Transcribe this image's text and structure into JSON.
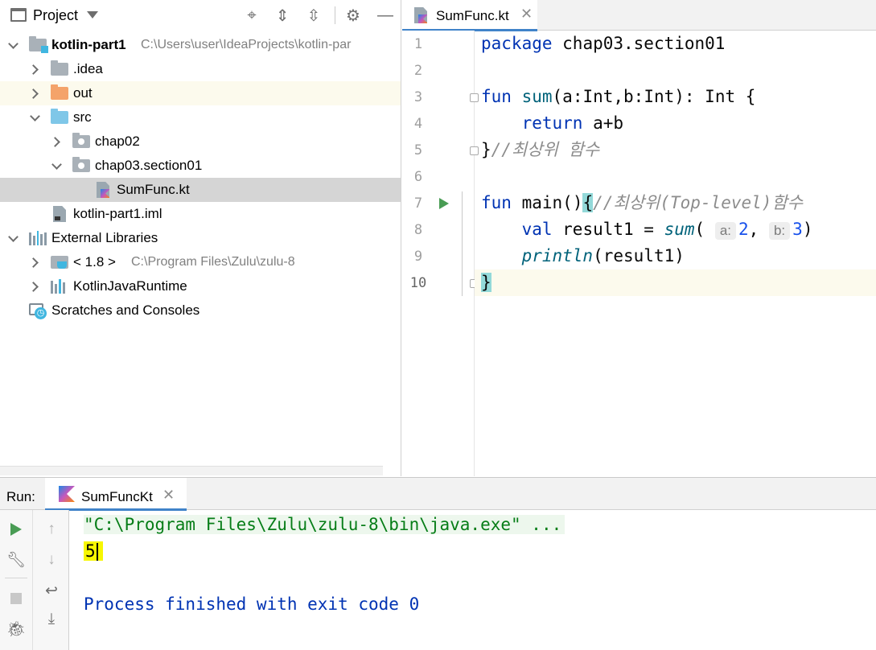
{
  "project_panel": {
    "title": "Project",
    "header_icons": [
      "locate-icon",
      "expand-all-icon",
      "collapse-all-icon",
      "gear-icon",
      "hide-icon"
    ],
    "tree": [
      {
        "label": "kotlin-part1",
        "path": "C:\\Users\\user\\IdeaProjects\\kotlin-par",
        "icon": "module-folder-icon",
        "expanded": true
      },
      {
        "label": ".idea",
        "icon": "folder-icon",
        "expanded": false
      },
      {
        "label": "out",
        "icon": "excluded-folder-icon",
        "expanded": false
      },
      {
        "label": "src",
        "icon": "source-folder-icon",
        "expanded": true
      },
      {
        "label": "chap02",
        "icon": "package-icon",
        "expanded": false
      },
      {
        "label": "chap03.section01",
        "icon": "package-icon",
        "expanded": true
      },
      {
        "label": "SumFunc.kt",
        "icon": "kotlin-file-icon",
        "selected": true
      },
      {
        "label": "kotlin-part1.iml",
        "icon": "iml-file-icon"
      },
      {
        "label": "External Libraries",
        "icon": "library-icon",
        "expanded": true
      },
      {
        "label": "< 1.8 >",
        "path": "C:\\Program Files\\Zulu\\zulu-8",
        "icon": "jdk-icon",
        "expanded": false
      },
      {
        "label": "KotlinJavaRuntime",
        "icon": "library-icon",
        "expanded": false
      },
      {
        "label": "Scratches and Consoles",
        "icon": "scratches-icon"
      }
    ]
  },
  "editor": {
    "tab_label": "SumFunc.kt",
    "tab_close": "✕",
    "line_numbers": [
      "1",
      "2",
      "3",
      "4",
      "5",
      "6",
      "7",
      "8",
      "9",
      "10"
    ],
    "code": {
      "l1_kw": "package",
      "l1_rest": " chap03.section01",
      "l3_kw": "fun",
      "l3_name": "sum",
      "l3_rest": "(a:Int,b:Int): Int {",
      "l4_kw": "return",
      "l4_rest": " a+b",
      "l5_brace": "}",
      "l5_comment": "//최상위 함수",
      "l7_kw": "fun",
      "l7_name": "main",
      "l7_paren": "()",
      "l7_brace": "{",
      "l7_comment": "//최상위(Top-level)함수",
      "l8_kw": "val",
      "l8_mid": " result1 = ",
      "l8_call": "sum",
      "l8_open": "( ",
      "l8_hint_a": "a:",
      "l8_num_a": "2",
      "l8_comma": ", ",
      "l8_hint_b": "b:",
      "l8_num_b": "3",
      "l8_close": ")",
      "l9_call": "println",
      "l9_rest": "(result1)",
      "l10_brace": "}"
    }
  },
  "run_panel": {
    "label": "Run:",
    "tab_label": "SumFuncKt",
    "tab_close": "✕",
    "console": {
      "command": "\"C:\\Program Files\\Zulu\\zulu-8\\bin\\java.exe\" ...",
      "output": "5",
      "finished": "Process finished with exit code 0"
    }
  },
  "colors": {
    "keyword": "#0033b3",
    "comment": "#8c8c8c",
    "number": "#1750eb",
    "selection": "#d5d5d5",
    "output_highlight": "#f7f700",
    "accent": "#4083c9"
  }
}
